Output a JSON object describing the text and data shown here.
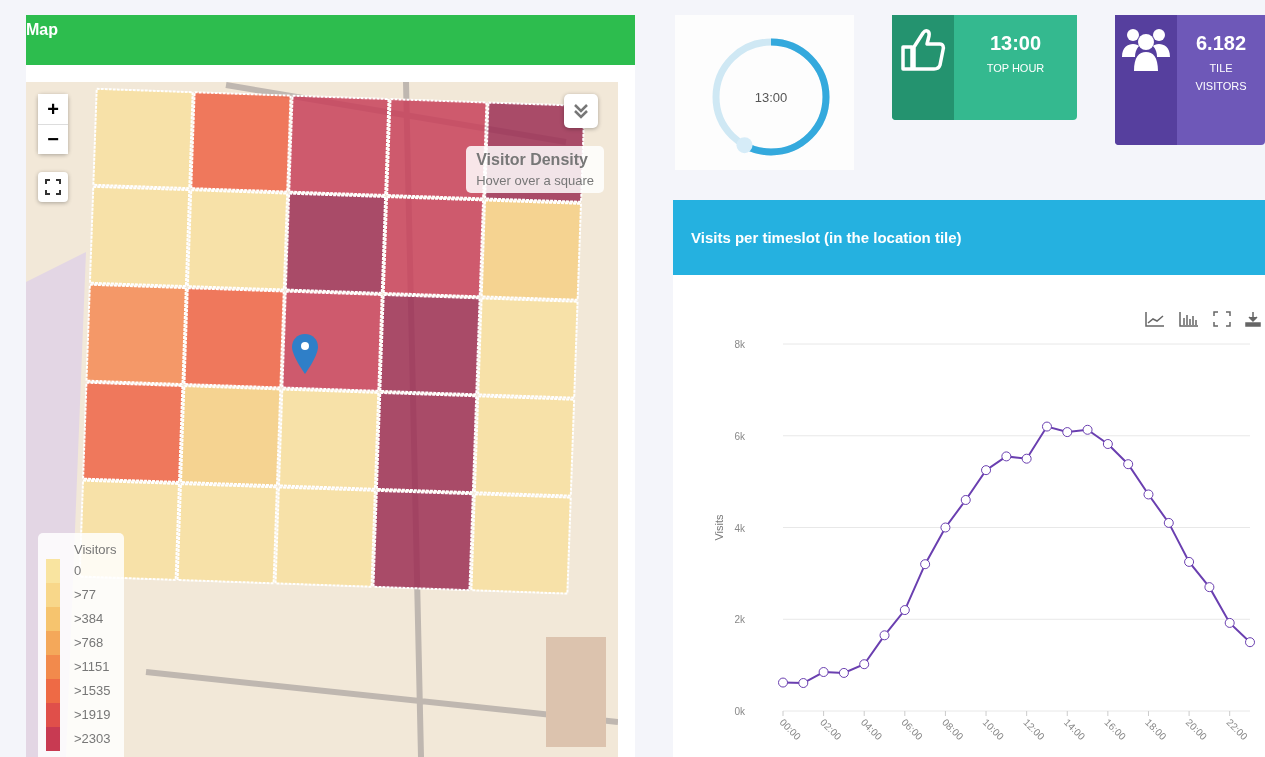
{
  "map_panel": {
    "title": "Map",
    "zoom_in": "+",
    "zoom_out": "−",
    "info_box": {
      "title": "Visitor Density",
      "hint": "Hover over a square"
    },
    "legend": {
      "title": "Visitors",
      "items": [
        {
          "label": "0",
          "color": "#f9e4a0"
        },
        {
          "label": ">77",
          "color": "#f8d78a"
        },
        {
          "label": ">384",
          "color": "#f6c46e"
        },
        {
          "label": ">768",
          "color": "#f4a85a"
        },
        {
          "label": ">1151",
          "color": "#f28a4c"
        },
        {
          "label": ">1535",
          "color": "#ee6a45"
        },
        {
          "label": ">1919",
          "color": "#e04f4a"
        },
        {
          "label": ">2303",
          "color": "#c83a52"
        }
      ]
    }
  },
  "gauge": {
    "value": "13:00",
    "level": 0.58
  },
  "stats": [
    {
      "kind": "thumbs",
      "value": "13:00",
      "label": "TOP HOUR"
    },
    {
      "kind": "people",
      "value": "6.182",
      "label": "TILE VISITORS"
    }
  ],
  "chart_panel": {
    "title": "Visits per timeslot (in the location tile)",
    "chart_data": {
      "type": "line",
      "ylabel": "Visits",
      "grid": true,
      "x": [
        0,
        1,
        2,
        3,
        4,
        5,
        6,
        7,
        8,
        9,
        10,
        11,
        12,
        13,
        14,
        15,
        16,
        17,
        18,
        19,
        20,
        21,
        22,
        23
      ],
      "series": [
        {
          "color": "#6a3fb0",
          "marker": "circle",
          "values": [
            620,
            610,
            850,
            830,
            1020,
            1650,
            2200,
            3200,
            4000,
            4600,
            5250,
            5550,
            5500,
            6200,
            6080,
            6130,
            5820,
            5380,
            4720,
            4100,
            3250,
            2700,
            1920,
            1500
          ]
        }
      ],
      "xticks": [
        {
          "value": 0,
          "label": "00:00"
        },
        {
          "value": 2,
          "label": "02:00"
        },
        {
          "value": 4,
          "label": "04:00"
        },
        {
          "value": 6,
          "label": "06:00"
        },
        {
          "value": 8,
          "label": "08:00"
        },
        {
          "value": 10,
          "label": "10:00"
        },
        {
          "value": 12,
          "label": "12:00"
        },
        {
          "value": 14,
          "label": "14:00"
        },
        {
          "value": 16,
          "label": "16:00"
        },
        {
          "value": 18,
          "label": "18:00"
        },
        {
          "value": 20,
          "label": "20:00"
        },
        {
          "value": 22,
          "label": "22:00"
        }
      ],
      "xlim": [
        0,
        23
      ],
      "ylim": [
        0,
        8000
      ],
      "yticks": [
        {
          "value": 0,
          "label": "0k"
        },
        {
          "value": 2000,
          "label": "2k"
        },
        {
          "value": 4000,
          "label": "4k"
        },
        {
          "value": 6000,
          "label": "6k"
        },
        {
          "value": 8000,
          "label": "8k"
        }
      ]
    }
  }
}
